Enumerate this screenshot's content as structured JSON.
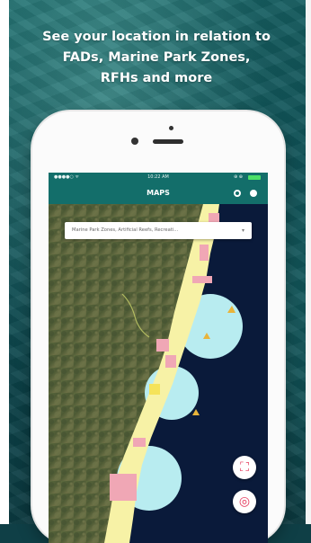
{
  "headline": {
    "line1": "See your location in relation to",
    "line2": "FADs, Marine Park Zones,",
    "line3": "RFHs and more"
  },
  "status_bar": {
    "carrier": "●●●●○ ᯤ",
    "time": "10:22 AM",
    "wifi": "⊕ ⊕"
  },
  "nav": {
    "title": "MAPS",
    "right_icons": [
      "gear-icon",
      "info-icon"
    ]
  },
  "layer_selector": {
    "text": "Marine Park Zones, Artificial Reefs, Recreati...",
    "caret": "▾"
  },
  "map_buttons": [
    {
      "name": "layers-icon",
      "glyph": "⛶"
    },
    {
      "name": "locate-icon",
      "glyph": "◎"
    }
  ],
  "colors": {
    "bar": "#136e6a",
    "ocean": "#0a1a3a",
    "zone_yellow": "#f7f2a6",
    "zone_cyan": "#b8ecf0",
    "zone_pink": "#f0a7b5",
    "accent_red": "#e4385b"
  }
}
